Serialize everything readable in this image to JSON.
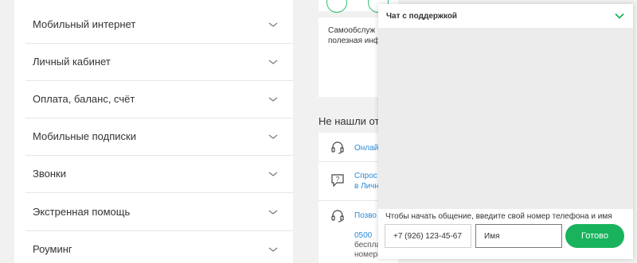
{
  "faq": {
    "items": [
      {
        "label": "Мобильный интернет"
      },
      {
        "label": "Личный кабинет"
      },
      {
        "label": "Оплата, баланс, счёт"
      },
      {
        "label": "Мобильные подписки"
      },
      {
        "label": "Звонки"
      },
      {
        "label": "Экстренная помощь"
      },
      {
        "label": "Роуминг"
      }
    ]
  },
  "info": {
    "selfcare_line1": "Самообслуж",
    "selfcare_line2": "полезная инф",
    "not_found": "Не нашли отв",
    "contacts": [
      {
        "link": "Онлай"
      },
      {
        "link_line1": "Спрос",
        "link_line2": "в Личн"
      },
      {
        "link": "Позво",
        "phone": "0500",
        "desc_line1": "беспла",
        "desc_line2": "номера"
      }
    ]
  },
  "chat": {
    "title": "Чат с поддержкой",
    "hint": "Чтобы начать общение, введите свой номер телефона и имя",
    "phone_value": "+7 (926) 123-45-67",
    "name_placeholder": "Имя",
    "submit_label": "Готово"
  },
  "colors": {
    "accent_green": "#18b35c",
    "link_blue": "#2a8ad4"
  }
}
